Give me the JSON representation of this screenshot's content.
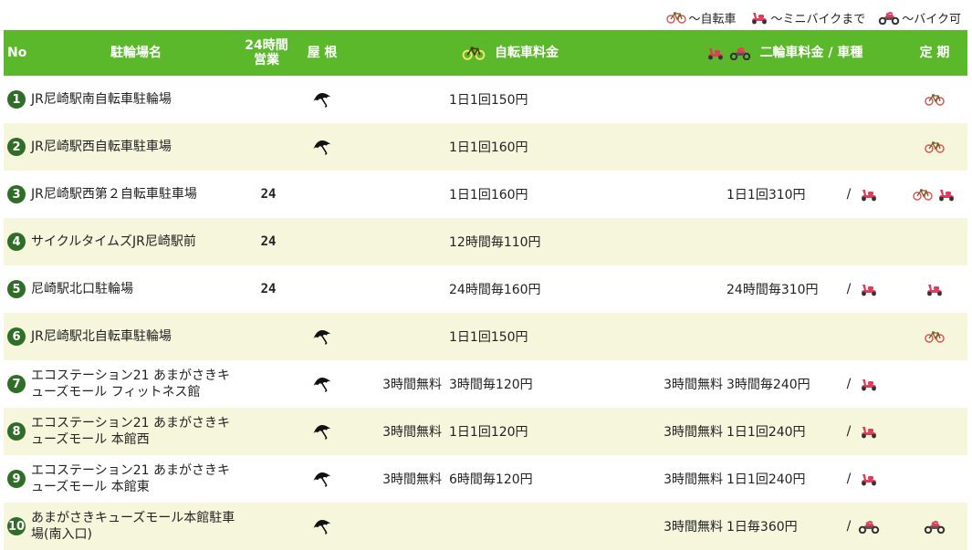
{
  "legend": {
    "bicycle": "～自転車",
    "minibike": "～ミニバイクまで",
    "bike": "～バイク可"
  },
  "header": {
    "no": "No",
    "name": "駐輪場名",
    "hours24_line1": "24時間",
    "hours24_line2": "営業",
    "roof": "屋 根",
    "bicycle_fee": "自転車料金",
    "moto_fee": "二輪車料金 / 車種",
    "season": "定 期"
  },
  "colors": {
    "header_green": "#5cb82b",
    "number_circle": "#2e6e27",
    "alt_row": "#f5f6dc",
    "scooter_red": "#e33b5a"
  },
  "rows": [
    {
      "no": "1",
      "name": "JR尼崎駅南自転車駐輪場",
      "h24": "",
      "roof": true,
      "bfree": "",
      "bfee": "1日1回150円",
      "mfree": "",
      "mfee": "",
      "mslash": "",
      "micon": "",
      "season": [
        "bicycle-icon"
      ]
    },
    {
      "no": "2",
      "name": "JR尼崎駅西自転車駐車場",
      "h24": "",
      "roof": true,
      "bfree": "",
      "bfee": "1日1回160円",
      "mfree": "",
      "mfee": "",
      "mslash": "",
      "micon": "",
      "season": [
        "bicycle-icon"
      ]
    },
    {
      "no": "3",
      "name": "JR尼崎駅西第２自転車駐車場",
      "h24": "24",
      "roof": false,
      "bfree": "",
      "bfee": "1日1回160円",
      "mfree": "",
      "mfee": "1日1回310円",
      "mslash": "/",
      "micon": "scooter-icon",
      "season": [
        "bicycle-icon",
        "scooter-icon"
      ]
    },
    {
      "no": "4",
      "name": "サイクルタイムズJR尼崎駅前",
      "h24": "24",
      "roof": false,
      "bfree": "",
      "bfee": "12時間毎110円",
      "mfree": "",
      "mfee": "",
      "mslash": "",
      "micon": "",
      "season": []
    },
    {
      "no": "5",
      "name": "尼崎駅北口駐輪場",
      "h24": "24",
      "roof": false,
      "bfree": "",
      "bfee": "24時間毎160円",
      "mfree": "",
      "mfee": "24時間毎310円",
      "mslash": "/",
      "micon": "scooter-icon",
      "season": [
        "scooter-icon"
      ]
    },
    {
      "no": "6",
      "name": "JR尼崎駅北自転車駐輪場",
      "h24": "",
      "roof": true,
      "bfree": "",
      "bfee": "1日1回150円",
      "mfree": "",
      "mfee": "",
      "mslash": "",
      "micon": "",
      "season": [
        "bicycle-icon"
      ]
    },
    {
      "no": "7",
      "name": "エコステーション21 あまがさきキューズモール フィットネス館",
      "h24": "",
      "roof": true,
      "bfree": "3時間無料",
      "bfee": "3時間毎120円",
      "mfree": "3時間無料",
      "mfee": "3時間毎240円",
      "mslash": "/",
      "micon": "scooter-icon",
      "season": []
    },
    {
      "no": "8",
      "name": "エコステーション21 あまがさきキューズモール 本館西",
      "h24": "",
      "roof": true,
      "bfree": "3時間無料",
      "bfee": "1日1回120円",
      "mfree": "3時間無料",
      "mfee": "1日1回240円",
      "mslash": "/",
      "micon": "scooter-icon",
      "season": []
    },
    {
      "no": "9",
      "name": "エコステーション21 あまがさきキューズモール 本館東",
      "h24": "",
      "roof": true,
      "bfree": "3時間無料",
      "bfee": "6時間毎120円",
      "mfree": "3時間無料",
      "mfee": "1日1回240円",
      "mslash": "/",
      "micon": "scooter-icon",
      "season": []
    },
    {
      "no": "10",
      "name": "あまがさきキューズモール本館駐車場(南入口)",
      "h24": "",
      "roof": true,
      "bfree": "",
      "bfee": "",
      "mfree": "3時間無料",
      "mfee": "1日毎360円",
      "mslash": "/",
      "micon": "motorbike-icon",
      "season": [
        "motorbike-icon"
      ]
    }
  ]
}
